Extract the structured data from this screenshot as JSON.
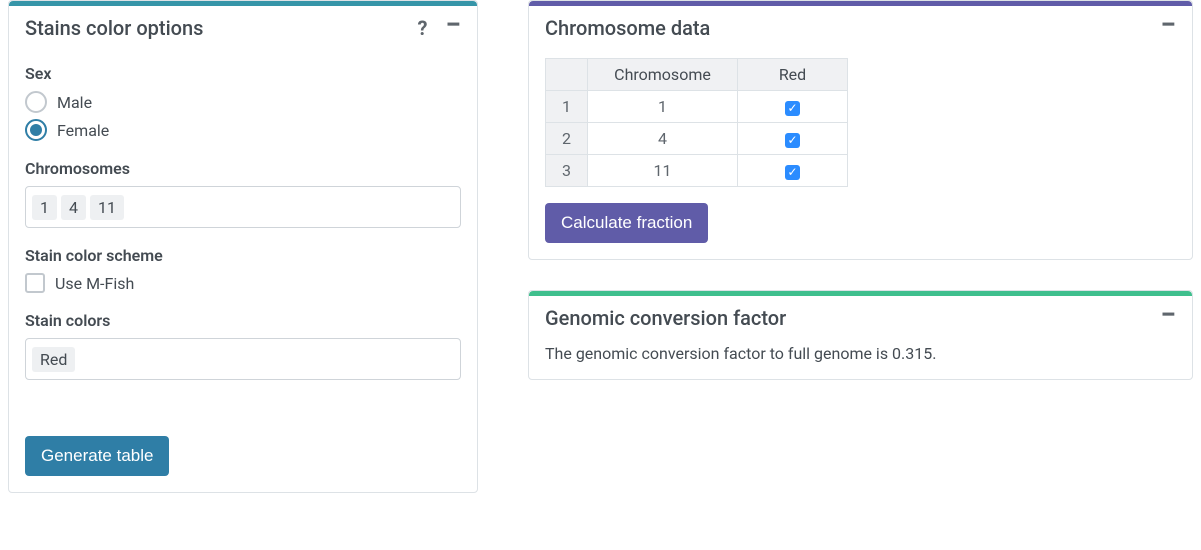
{
  "colors": {
    "teal": "#2f7ea6",
    "purple": "#605ca8",
    "green": "#3fbf8d"
  },
  "left": {
    "title": "Stains color options",
    "sex": {
      "label": "Sex",
      "options": {
        "male": "Male",
        "female": "Female"
      },
      "selected": "female"
    },
    "chromosomes": {
      "label": "Chromosomes",
      "tags": [
        "1",
        "4",
        "11"
      ]
    },
    "scheme": {
      "label": "Stain color scheme",
      "mfish_label": "Use M-Fish",
      "mfish_checked": false
    },
    "stain_colors": {
      "label": "Stain colors",
      "tags": [
        "Red"
      ]
    },
    "generate_btn": "Generate table"
  },
  "chrom": {
    "title": "Chromosome data",
    "headers": {
      "chrom": "Chromosome",
      "red": "Red"
    },
    "rows": [
      {
        "idx": "1",
        "chrom": "1",
        "red": true
      },
      {
        "idx": "2",
        "chrom": "4",
        "red": true
      },
      {
        "idx": "3",
        "chrom": "11",
        "red": true
      }
    ],
    "calc_btn": "Calculate fraction"
  },
  "factor": {
    "title": "Genomic conversion factor",
    "text": "The genomic conversion factor to full genome is 0.315."
  }
}
